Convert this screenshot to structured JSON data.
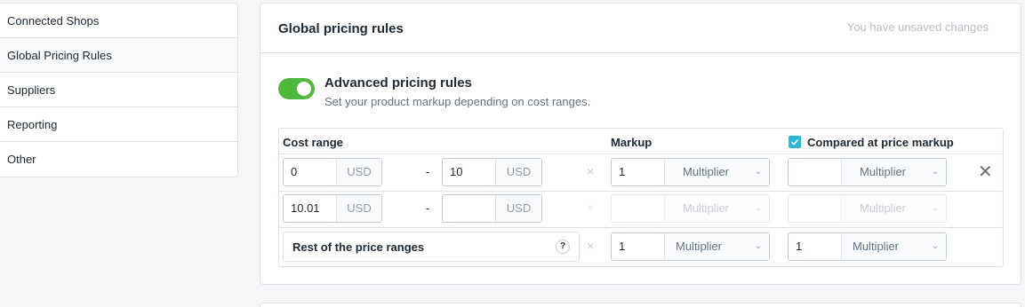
{
  "sidebar": {
    "items": [
      {
        "label": "Connected Shops"
      },
      {
        "label": "Global Pricing Rules"
      },
      {
        "label": "Suppliers"
      },
      {
        "label": "Reporting"
      },
      {
        "label": "Other"
      }
    ],
    "active_index": 1
  },
  "card": {
    "title": "Global pricing rules",
    "unsaved_text": "You have unsaved changes"
  },
  "advanced": {
    "enabled": true,
    "title": "Advanced pricing rules",
    "subtitle": "Set your product markup depending on cost ranges."
  },
  "table": {
    "headers": {
      "cost_range": "Cost range",
      "markup": "Markup",
      "compared": "Compared at price markup"
    },
    "compared_checked": true,
    "rows": [
      {
        "from": "0",
        "from_unit": "USD",
        "dash": "-",
        "to": "10",
        "to_unit": "USD",
        "markup": "1",
        "markup_type": "Multiplier",
        "compared": "",
        "compared_type": "Multiplier"
      },
      {
        "from": "10.01",
        "from_unit": "USD",
        "dash": "-",
        "to": "",
        "to_unit": "USD",
        "markup": "",
        "markup_type": "Multiplier",
        "compared": "",
        "compared_type": "Multiplier"
      }
    ],
    "rest": {
      "label": "Rest of the price ranges",
      "help": "?",
      "markup": "1",
      "markup_type": "Multiplier",
      "compared": "1",
      "compared_type": "Multiplier"
    }
  },
  "icons": {
    "delete_small": "×",
    "delete_row": "✕",
    "chevron": "⌄"
  },
  "colors": {
    "toggle_on": "#50b83c",
    "checkbox": "#2eb8d6",
    "unsaved": "#b9c0ca"
  }
}
